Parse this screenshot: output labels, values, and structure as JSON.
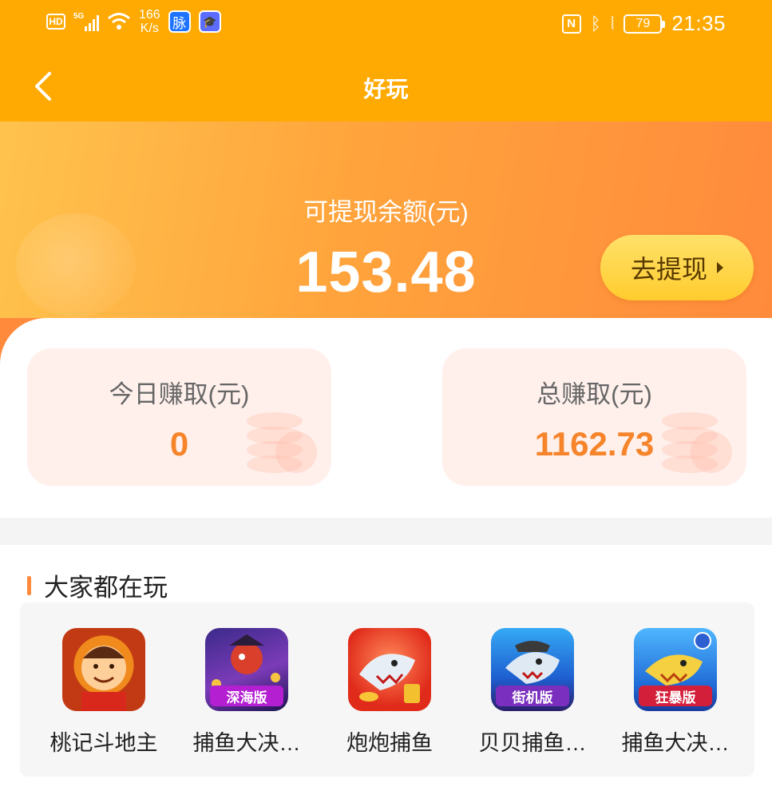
{
  "status_bar": {
    "hd": "HD",
    "network": "5G",
    "speed_value": "166",
    "speed_unit": "K/s",
    "app_badge_1": "脉",
    "nfc": "N",
    "battery": "79",
    "time": "21:35"
  },
  "header": {
    "title": "好玩"
  },
  "balance": {
    "label": "可提现余额(元)",
    "value": "153.48",
    "withdraw_label": "去提现"
  },
  "earnings": {
    "today_label": "今日赚取(元)",
    "today_value": "0",
    "total_label": "总赚取(元)",
    "total_value": "1162.73"
  },
  "games_section": {
    "title": "大家都在玩",
    "items": [
      {
        "name": "桃记斗地主",
        "icon": "landlord-game-icon"
      },
      {
        "name": "捕鱼大决…",
        "icon": "fishing-deepsea-icon",
        "tag": "深海版"
      },
      {
        "name": "炮炮捕鱼",
        "icon": "shark-game-icon"
      },
      {
        "name": "贝贝捕鱼…",
        "icon": "fishing-arcade-icon",
        "tag": "街机版"
      },
      {
        "name": "捕鱼大决…",
        "icon": "fishing-frenzy-icon",
        "tag": "狂暴版"
      }
    ]
  },
  "colors": {
    "header": "#ffaa03",
    "accent": "#f6842a",
    "withdraw_button": "#ffd63f"
  }
}
